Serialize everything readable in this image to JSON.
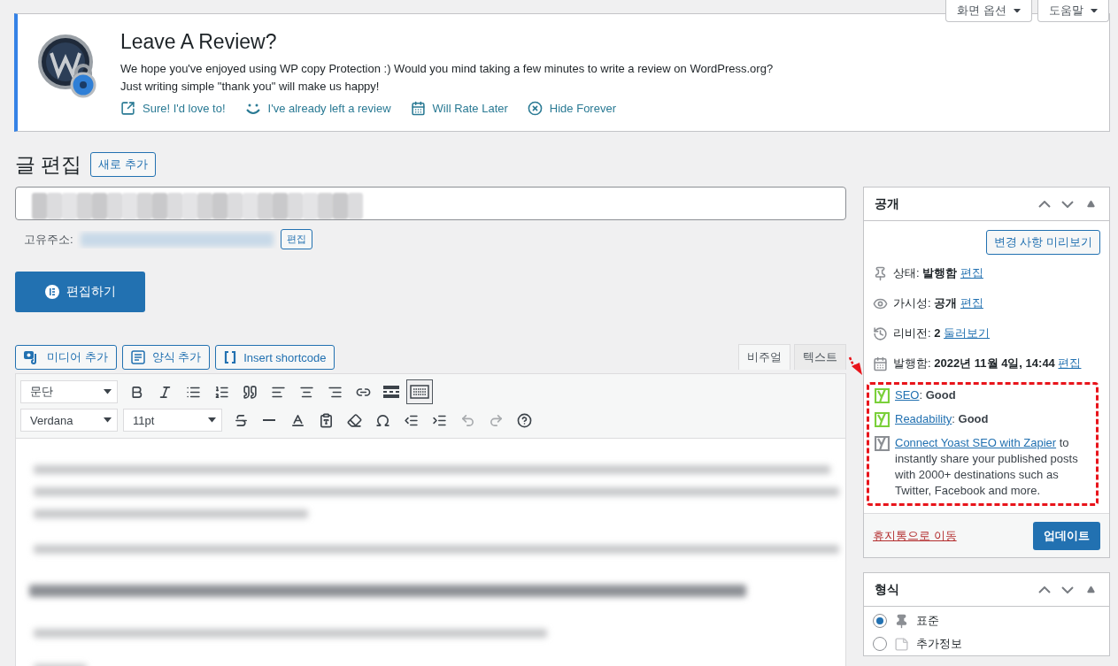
{
  "screen_meta": [
    {
      "label": "화면 옵션"
    },
    {
      "label": "도움말"
    }
  ],
  "notice": {
    "title": "Leave A Review?",
    "lines": [
      "We hope you've enjoyed using WP copy Protection :) Would you mind taking a few minutes to write a review on WordPress.org?",
      "Just writing simple \"thank you\" will make us happy!"
    ],
    "actions": [
      {
        "kind": "external",
        "label": "Sure! I'd love to!"
      },
      {
        "kind": "smile",
        "label": "I've already left a review"
      },
      {
        "kind": "calendar",
        "label": "Will Rate Later"
      },
      {
        "kind": "dismiss",
        "label": "Hide Forever"
      }
    ]
  },
  "heading": {
    "title": "글 편집",
    "add_new": "새로 추가"
  },
  "permalink": {
    "label": "고유주소:",
    "edit": "편집"
  },
  "builder_button": "편집하기",
  "media_buttons": [
    {
      "kind": "media",
      "label": "미디어 추가"
    },
    {
      "kind": "form",
      "label": "양식 추가"
    },
    {
      "kind": "shortcode",
      "label": "Insert shortcode"
    }
  ],
  "editor_tabs": [
    {
      "label": "비주얼",
      "selected": true
    },
    {
      "label": "텍스트",
      "selected": false
    }
  ],
  "toolbar_rows": [
    [
      {
        "kind": "select",
        "value": "문단"
      },
      {
        "kind": "bold"
      },
      {
        "kind": "italic"
      },
      {
        "kind": "bullets"
      },
      {
        "kind": "numbers"
      },
      {
        "kind": "quote"
      },
      {
        "kind": "align-left"
      },
      {
        "kind": "align-center"
      },
      {
        "kind": "align-right"
      },
      {
        "kind": "link"
      },
      {
        "kind": "more"
      },
      {
        "kind": "toggle",
        "pressed": true
      }
    ],
    [
      {
        "kind": "select",
        "value": "Verdana"
      },
      {
        "kind": "select",
        "value": "11pt"
      },
      {
        "kind": "strike"
      },
      {
        "kind": "hr"
      },
      {
        "kind": "color"
      },
      {
        "kind": "paste"
      },
      {
        "kind": "eraser"
      },
      {
        "kind": "omega"
      },
      {
        "kind": "outdent"
      },
      {
        "kind": "indent"
      },
      {
        "kind": "undo",
        "disabled": true
      },
      {
        "kind": "redo",
        "disabled": true
      },
      {
        "kind": "help"
      }
    ]
  ],
  "publish": {
    "title": "공개",
    "preview": "변경 사항 미리보기",
    "rows": [
      {
        "kind": "pin",
        "label": "상태:",
        "value": "발행함",
        "link": "편집"
      },
      {
        "kind": "eye",
        "label": "가시성:",
        "value": "공개",
        "link": "편집"
      },
      {
        "kind": "history",
        "label": "리비전:",
        "value": "2",
        "link": "둘러보기"
      },
      {
        "kind": "calendar",
        "label": "발행함:",
        "value": "2022년 11월 4일, 14:44",
        "link": "편집"
      }
    ],
    "yoast": {
      "highlighted": true,
      "scores": [
        {
          "link": "SEO",
          "text": ": **Good**",
          "color": "#7ad03a"
        },
        {
          "link": "Readability",
          "text": ": **Good**",
          "color": "#7ad03a"
        }
      ],
      "promo": {
        "link": "Connect Yoast SEO with Zapier",
        "text": " to instantly share your published posts with 2000+ destinations such as Twitter, Facebook and more."
      }
    },
    "trash": "휴지통으로 이동",
    "update": "업데이트"
  },
  "format": {
    "title": "형식",
    "options": [
      {
        "kind": "pin",
        "label": "표준",
        "selected": true
      },
      {
        "kind": "aside",
        "label": "추가정보",
        "selected": false
      }
    ]
  }
}
